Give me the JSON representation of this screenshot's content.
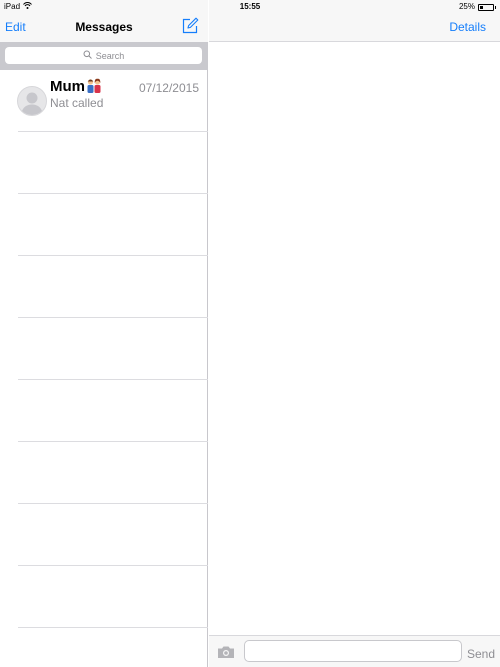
{
  "status_bar": {
    "device": "iPad",
    "time": "15:55",
    "battery": "25%",
    "wifi_icon": "wifi-icon",
    "battery_icon": "battery-icon"
  },
  "left": {
    "edit_label": "Edit",
    "title": "Messages",
    "compose_icon": "compose-icon",
    "search_placeholder": "Search",
    "search_icon": "search-icon"
  },
  "conversations": [
    {
      "name": "Mum",
      "emoji_icon": "family-emoji-icon",
      "date": "07/12/2015",
      "preview": "Nat called"
    }
  ],
  "right": {
    "details_label": "Details",
    "camera_icon": "camera-icon",
    "message_value": "",
    "send_label": "Send"
  },
  "colors": {
    "accent": "#157efb",
    "secondary_text": "#8e8e93",
    "bar_bg": "#f7f7f7",
    "search_bg": "#c9c9ce",
    "separator": "#dcdce0"
  }
}
